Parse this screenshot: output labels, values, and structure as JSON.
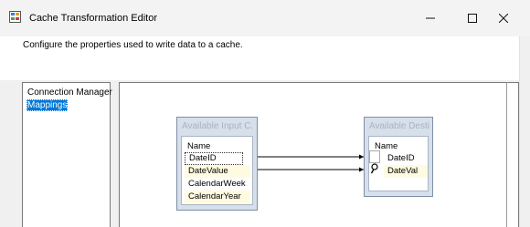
{
  "window": {
    "title": "Cache Transformation Editor",
    "minimize_icon": "minimize-icon",
    "maximize_icon": "maximize-icon",
    "close_icon": "close-icon"
  },
  "header": {
    "description": "Configure the properties used to write data to a cache."
  },
  "nav": {
    "items": [
      {
        "label": "Connection Manager",
        "selected": false
      },
      {
        "label": "Mappings",
        "selected": true
      }
    ]
  },
  "mappings": {
    "input_table": {
      "title": "Available Input C...",
      "column_header": "Name",
      "columns": [
        "DateID",
        "DateValue",
        "CalendarWeek",
        "CalendarYear"
      ]
    },
    "dest_table": {
      "title": "Available Desti...",
      "column_header": "Name",
      "columns": [
        "DateID",
        "DateVal"
      ]
    }
  },
  "colors": {
    "selection": "#0078d7",
    "table_header": "#d6dfea",
    "mapped_row": "#fffbe0"
  }
}
